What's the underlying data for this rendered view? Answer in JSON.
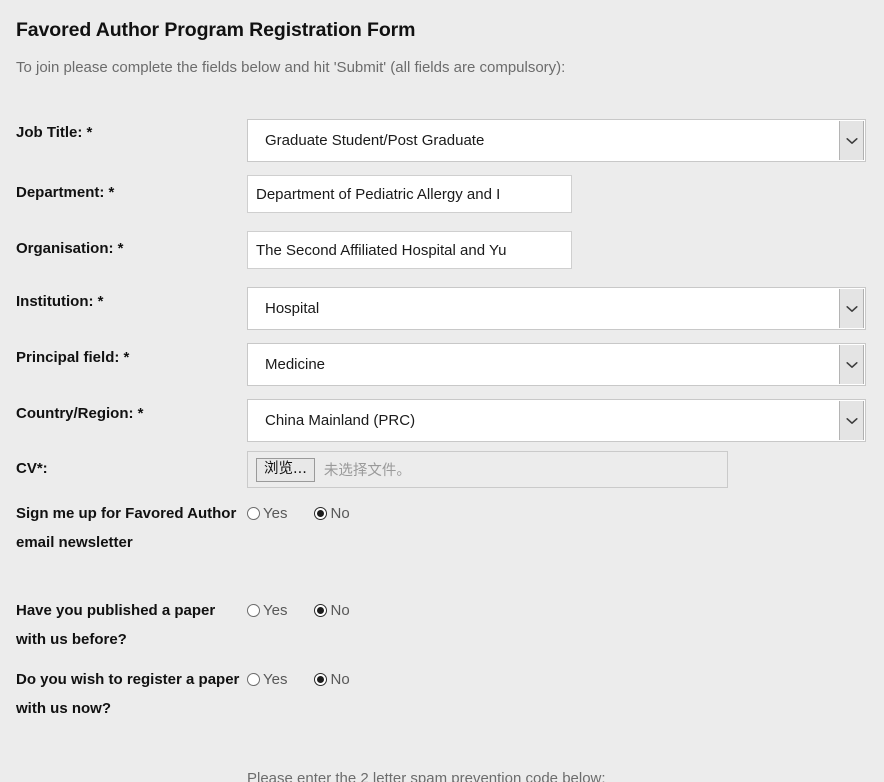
{
  "header": {
    "title": "Favored Author Program Registration Form",
    "subtitle": "To join please complete the fields below and hit 'Submit' (all fields are compulsory):"
  },
  "fields": {
    "job_title": {
      "label": "Job Title: *",
      "type": "select",
      "value": "Graduate Student/Post Graduate"
    },
    "department": {
      "label": "Department: *",
      "type": "text",
      "value": "Department of Pediatric Allergy and I",
      "placeholder": ""
    },
    "organisation": {
      "label": "Organisation: *",
      "type": "text",
      "value": "The Second Affiliated Hospital and Yu",
      "placeholder": ""
    },
    "institution": {
      "label": "Institution: *",
      "type": "select",
      "value": "Hospital"
    },
    "principal_field": {
      "label": "Principal field: *",
      "type": "select",
      "value": "Medicine"
    },
    "country_region": {
      "label": "Country/Region: *",
      "type": "select",
      "value": "China Mainland (PRC)"
    },
    "cv": {
      "label": "CV*:",
      "type": "file",
      "button_label": "浏览...",
      "status_text": "未选择文件。"
    },
    "newsletter": {
      "label": "Sign me up for Favored Author email newsletter",
      "type": "radio",
      "yes_label": "Yes",
      "no_label": "No",
      "selected": "No"
    },
    "published_before": {
      "label": "Have you published a paper with us before?",
      "type": "radio",
      "yes_label": "Yes",
      "no_label": "No",
      "selected": "No"
    },
    "register_paper": {
      "label": "Do you wish to register a paper with us now?",
      "type": "radio",
      "yes_label": "Yes",
      "no_label": "No",
      "selected": "No"
    }
  },
  "footer": {
    "spam_note": "Please enter the 2 letter spam prevention code below:"
  },
  "icons": {
    "chevron_down": "chevron-down-icon"
  },
  "colors": {
    "page_background": "#ececec",
    "input_background": "#ffffff",
    "label_text": "#111111",
    "muted_text": "#6c6c6c",
    "border": "#c8c8c8"
  }
}
